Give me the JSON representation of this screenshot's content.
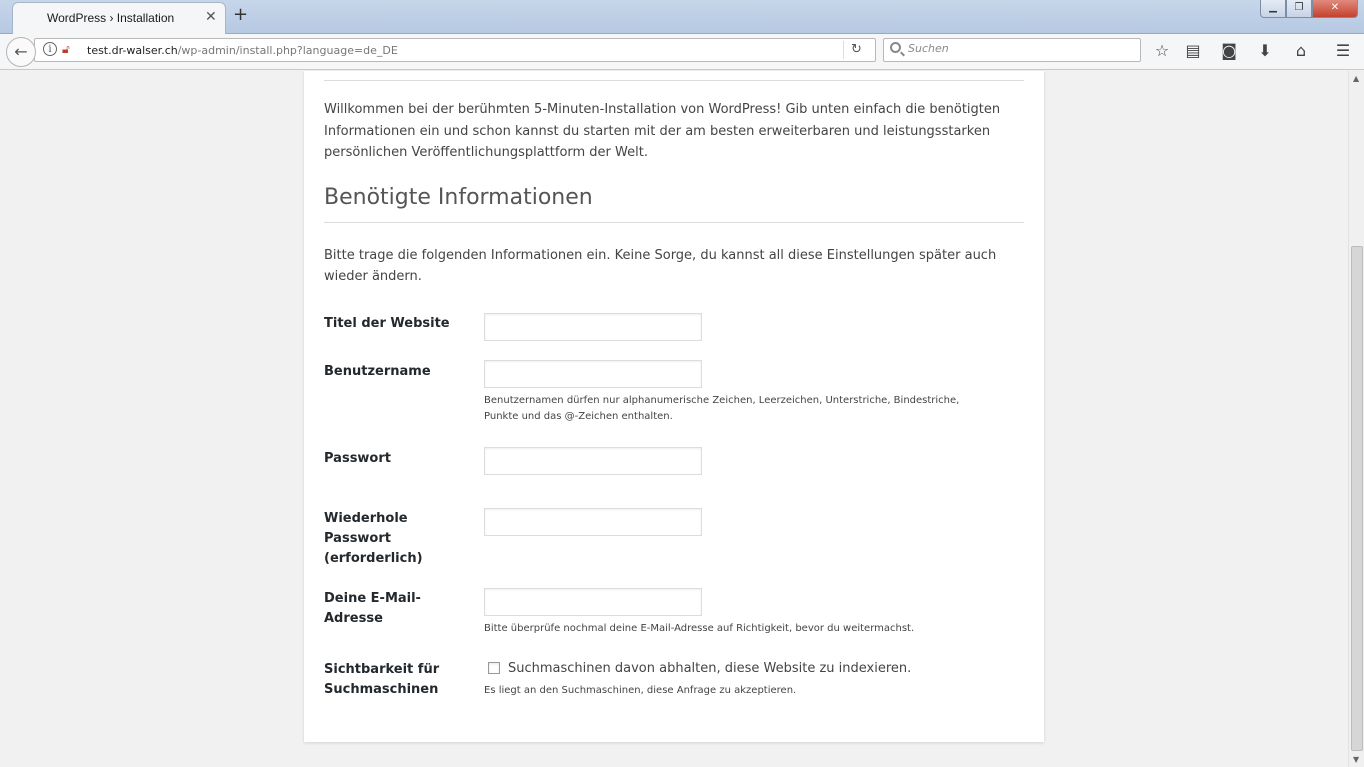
{
  "browser": {
    "tab_title": "WordPress › Installation",
    "tab_close": "✕",
    "new_tab": "+",
    "window_buttons": {
      "minimize": "▁",
      "maximize": "❐",
      "close": "✕"
    },
    "url_host": "test.dr-walser.ch",
    "url_path": "/wp-admin/install.php?language=de_DE",
    "search_placeholder": "Suchen",
    "icons": [
      "back-icon",
      "info-icon",
      "insecure-lock-icon",
      "reload-icon",
      "search-icon",
      "bookmark-star-icon",
      "reading-list-icon",
      "pocket-icon",
      "download-icon",
      "home-icon",
      "menu-icon"
    ]
  },
  "page": {
    "intro": "Willkommen bei der berühmten 5-Minuten-Installation von WordPress! Gib unten einfach die benötigten Informationen ein und schon kannst du starten mit der am besten erweiterbaren und leistungsstarken persönlichen Veröffentlichungsplattform der Welt.",
    "heading": "Benötigte Informationen",
    "description": "Bitte trage die folgenden Informationen ein. Keine Sorge, du kannst all diese Einstellungen später auch wieder ändern.",
    "form": {
      "site_title_label": "Titel der Website",
      "site_title_value": "",
      "username_label": "Benutzername",
      "username_value": "",
      "username_hint": "Benutzernamen dürfen nur alphanumerische Zeichen, Leerzeichen, Unterstriche, Bindestriche, Punkte und das @-Zeichen enthalten.",
      "password_label": "Passwort",
      "password_value": "",
      "password_repeat_label": "Wiederhole Passwort (erforderlich)",
      "password_repeat_value": "",
      "email_label": "Deine E-Mail-Adresse",
      "email_value": "",
      "email_hint": "Bitte überprüfe nochmal deine E-Mail-Adresse auf Richtigkeit, bevor du weitermachst.",
      "visibility_label": "Sichtbarkeit für Suchmaschinen",
      "visibility_checkbox_label": "Suchmaschinen davon abhalten, diese Website zu indexieren.",
      "visibility_checked": false,
      "visibility_hint": "Es liegt an den Suchmaschinen, diese Anfrage zu akzeptieren."
    }
  }
}
